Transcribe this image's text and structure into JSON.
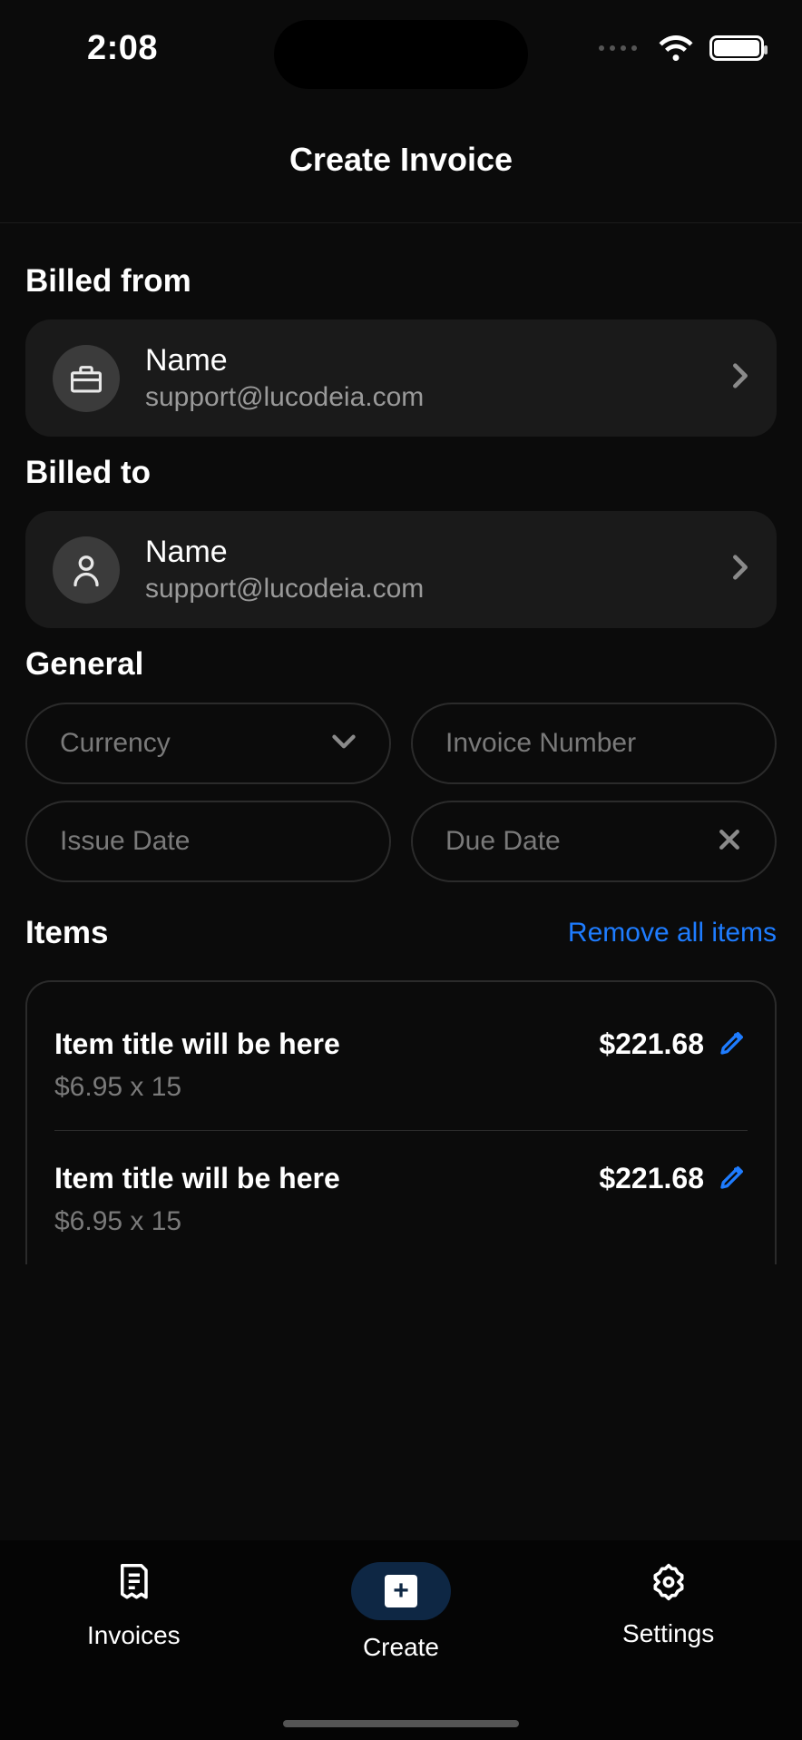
{
  "status": {
    "time": "2:08"
  },
  "header": {
    "title": "Create Invoice"
  },
  "sections": {
    "billed_from": {
      "title": "Billed from",
      "name": "Name",
      "email": "support@lucodeia.com"
    },
    "billed_to": {
      "title": "Billed to",
      "name": "Name",
      "email": "support@lucodeia.com"
    },
    "general": {
      "title": "General",
      "currency_label": "Currency",
      "invoice_number_label": "Invoice Number",
      "issue_date_label": "Issue Date",
      "due_date_label": "Due Date"
    },
    "items": {
      "title": "Items",
      "remove_all": "Remove all items",
      "list": [
        {
          "title": "Item title will be here",
          "sub": "$6.95 x 15",
          "amount": "$221.68"
        },
        {
          "title": "Item title will be here",
          "sub": "$6.95 x 15",
          "amount": "$221.68"
        }
      ]
    }
  },
  "tabbar": {
    "invoices": "Invoices",
    "create": "Create",
    "settings": "Settings"
  },
  "colors": {
    "accent": "#1e7cff"
  }
}
